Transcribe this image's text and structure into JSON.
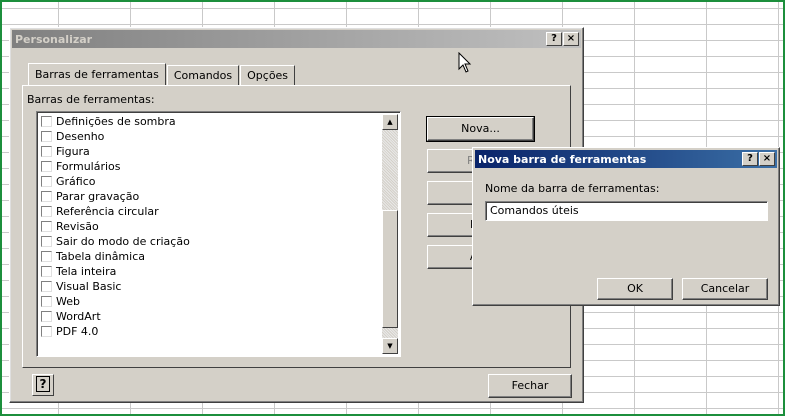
{
  "main_dialog": {
    "title": "Personalizar",
    "help_button": "?",
    "close_button": "×",
    "tabs": [
      {
        "label": "Barras de ferramentas",
        "accel": "f",
        "active": true
      },
      {
        "label": "Comandos",
        "accel": "m",
        "active": false
      },
      {
        "label": "Opções",
        "accel": "p",
        "active": false
      }
    ],
    "list_label": "Barras de ferramentas:",
    "toolbars": [
      {
        "label": "Definições de sombra",
        "checked": false
      },
      {
        "label": "Desenho",
        "checked": false
      },
      {
        "label": "Figura",
        "checked": false
      },
      {
        "label": "Formulários",
        "checked": false
      },
      {
        "label": "Gráfico",
        "checked": false
      },
      {
        "label": "Parar gravação",
        "checked": false
      },
      {
        "label": "Referência circular",
        "checked": false
      },
      {
        "label": "Revisão",
        "checked": false
      },
      {
        "label": "Sair do modo de criação",
        "checked": false
      },
      {
        "label": "Tabela dinâmica",
        "checked": false
      },
      {
        "label": "Tela inteira",
        "checked": false
      },
      {
        "label": "Visual Basic",
        "checked": false
      },
      {
        "label": "Web",
        "checked": false
      },
      {
        "label": "WordArt",
        "checked": false
      },
      {
        "label": "PDF 4.0",
        "checked": false
      }
    ],
    "buttons": {
      "nova": "Nova...",
      "renomear": "Renc",
      "excluir": "Ex",
      "redefinir": "Red",
      "anexar": "Ane"
    },
    "footer_help": "?",
    "fechar": "Fechar"
  },
  "new_toolbar_dialog": {
    "title": "Nova barra de ferramentas",
    "help_button": "?",
    "close_button": "×",
    "field_label": "Nome da barra de ferramentas:",
    "field_value": "Comandos úteis",
    "ok": "OK",
    "cancel": "Cancelar"
  },
  "colors": {
    "dialog_face": "#d4d0c8",
    "active_title": "#0a246a",
    "inactive_title": "#808080",
    "sheet_border": "#1c8f3c"
  }
}
